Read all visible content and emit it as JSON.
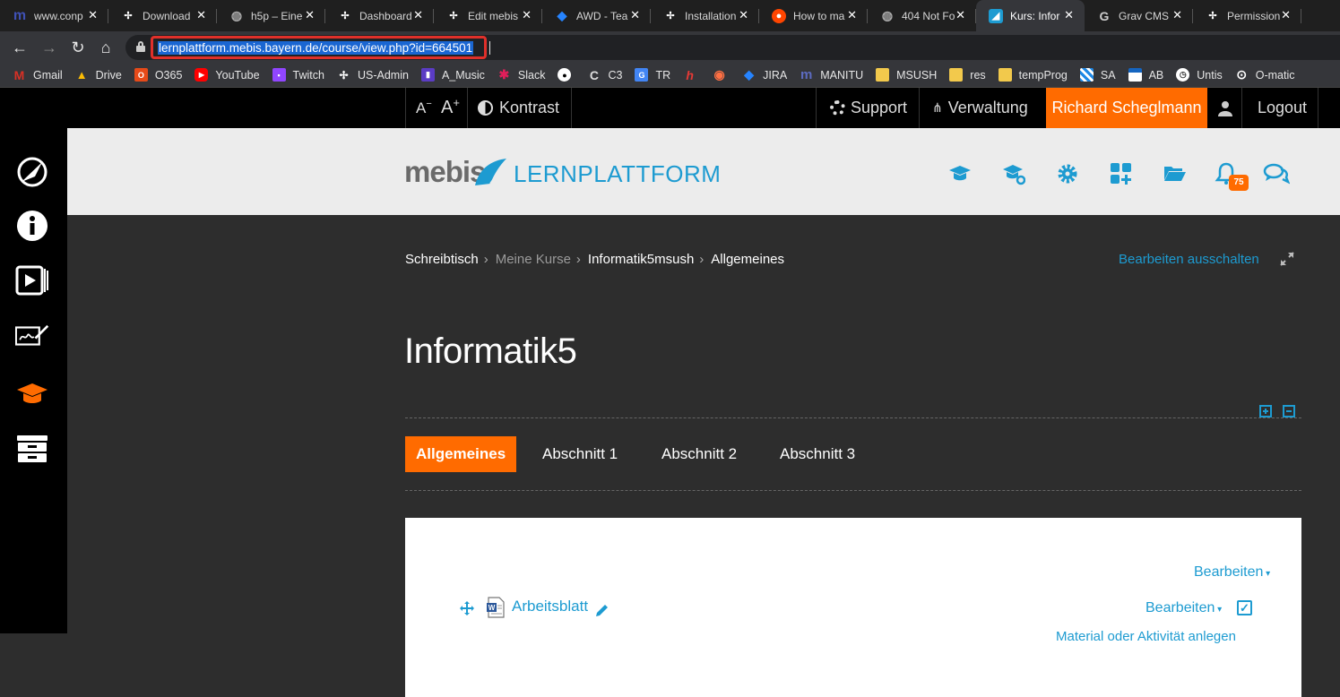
{
  "tabs": [
    {
      "label": "www.conp",
      "icon": "m-icon",
      "active": false
    },
    {
      "label": "Download",
      "icon": "grav-icon",
      "active": false
    },
    {
      "label": "h5p – Eine",
      "icon": "globe-icon",
      "active": false
    },
    {
      "label": "Dashboard",
      "icon": "grav-icon",
      "active": false
    },
    {
      "label": "Edit mebis",
      "icon": "grav-icon",
      "active": false
    },
    {
      "label": "AWD - Tea",
      "icon": "jira-icon",
      "active": false
    },
    {
      "label": "Installation",
      "icon": "grav-icon",
      "active": false
    },
    {
      "label": "How to ma",
      "icon": "reddit-icon",
      "active": false
    },
    {
      "label": "404 Not Fo",
      "icon": "globe-icon",
      "active": false
    },
    {
      "label": "Kurs: Infor",
      "icon": "mebis-icon",
      "active": true
    },
    {
      "label": "Grav CMS",
      "icon": "g-icon",
      "active": false
    },
    {
      "label": "Permission",
      "icon": "grav-icon",
      "active": false
    }
  ],
  "address": {
    "url": "lernplattform.mebis.bayern.de/course/view.php?id=664501"
  },
  "bookmarks": [
    {
      "label": "Gmail",
      "icon": "gmail-icon",
      "color": "#d93025"
    },
    {
      "label": "Drive",
      "icon": "drive-icon",
      "color": "#1fa463"
    },
    {
      "label": "O365",
      "icon": "office-icon",
      "color": "#e64a19"
    },
    {
      "label": "YouTube",
      "icon": "youtube-icon",
      "color": "#ff0000"
    },
    {
      "label": "Twitch",
      "icon": "twitch-icon",
      "color": "#9146ff"
    },
    {
      "label": "US-Admin",
      "icon": "grav-icon",
      "color": "#444444"
    },
    {
      "label": "A_Music",
      "icon": "music-icon",
      "color": "#5b3cc4"
    },
    {
      "label": "Slack",
      "icon": "slack-icon",
      "color": "#611f69"
    },
    {
      "label": "",
      "icon": "github-icon",
      "color": "#444444"
    },
    {
      "label": "C3",
      "icon": "c3-icon",
      "color": "#888888"
    },
    {
      "label": "TR",
      "icon": "translate-icon",
      "color": "#4285f4"
    },
    {
      "label": "",
      "icon": "h-icon",
      "color": "#c62828"
    },
    {
      "label": "",
      "icon": "ring-icon",
      "color": "#e65100"
    },
    {
      "label": "JIRA",
      "icon": "jira-icon",
      "color": "#2684ff"
    },
    {
      "label": "MANITU",
      "icon": "m-icon",
      "color": "#3f51b5"
    },
    {
      "label": "MSUSH",
      "icon": "folder-icon",
      "color": "#f2c94c"
    },
    {
      "label": "res",
      "icon": "folder-icon",
      "color": "#f2c94c"
    },
    {
      "label": "tempProg",
      "icon": "folder-icon",
      "color": "#f2c94c"
    },
    {
      "label": "SA",
      "icon": "bavaria-icon",
      "color": "#1e88e5"
    },
    {
      "label": "AB",
      "icon": "ab-icon",
      "color": "#1565c0"
    },
    {
      "label": "Untis",
      "icon": "clock-icon",
      "color": "#eeeeee"
    },
    {
      "label": "O-matic",
      "icon": "o-icon",
      "color": "#333333"
    }
  ],
  "topnav": {
    "font_smaller": "A",
    "font_larger": "A",
    "contrast_label": "Kontrast",
    "support_label": "Support",
    "admin_label": "Verwaltung",
    "user_label": "Richard Scheglmann",
    "logout_label": "Logout"
  },
  "header": {
    "logo_main": "mebis",
    "logo_sub": "LERNPLATTFORM",
    "notification_count": "75",
    "accent": "#1d9bd1"
  },
  "breadcrumb": {
    "items": [
      "Schreibtisch",
      "Meine Kurse",
      "Informatik5msush",
      "Allgemeines"
    ],
    "separator": "›"
  },
  "edit_toggle_label": "Bearbeiten ausschalten",
  "course": {
    "title": "Informatik5",
    "sections": [
      "Allgemeines",
      "Abschnitt 1",
      "Abschnitt 2",
      "Abschnitt 3"
    ],
    "active_section": "Allgemeines"
  },
  "content": {
    "edit_label": "Bearbeiten",
    "activity_name": "Arbeitsblatt",
    "activity_edit_label": "Bearbeiten",
    "cut_text": "Material oder Aktivität anlegen"
  },
  "colors": {
    "orange": "#ff6b00",
    "blue": "#1d9bd1"
  }
}
